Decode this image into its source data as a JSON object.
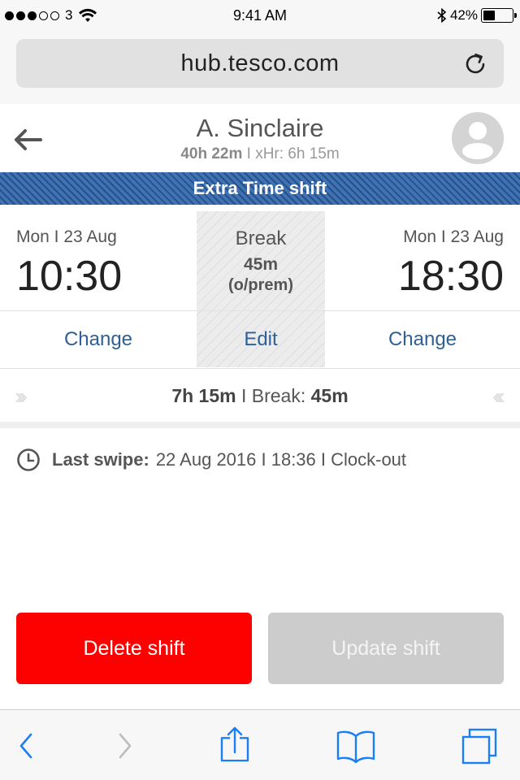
{
  "status_bar": {
    "signal_strength": "3 of 5",
    "carrier": "3",
    "time": "9:41 AM",
    "battery": "42%",
    "battery_level": 0.42
  },
  "browser": {
    "url": "hub.tesco.com"
  },
  "header": {
    "employee_name": "A. Sinclaire",
    "hours_total": "40h 22m",
    "hours_extra": "I xHr: 6h 15m"
  },
  "banner": {
    "label": "Extra Time shift"
  },
  "shift": {
    "start_day": "Mon I 23 Aug",
    "start_time": "10:30",
    "break_label": "Break",
    "break_value": "45m",
    "break_type": "(o/prem)",
    "end_day": "Mon I 23 Aug",
    "end_time": "18:30",
    "change_start_label": "Change",
    "edit_break_label": "Edit",
    "change_end_label": "Change"
  },
  "duration": {
    "total": "7h 15m",
    "break_prefix": " I Break: ",
    "break": "45m",
    "chevrons_left": "›››",
    "chevrons_right": "‹‹‹"
  },
  "last_swipe": {
    "label": "Last swipe:",
    "value": "22 Aug 2016 I 18:36 I Clock-out"
  },
  "actions": {
    "delete_label": "Delete shift",
    "update_label": "Update shift"
  },
  "colors": {
    "banner": "#3f73b4",
    "link": "#2f5f96",
    "delete": "#fd0000",
    "update_disabled": "#cccccc",
    "ios_blue": "#1a7ef5"
  },
  "icons": {
    "back": "arrow-left-icon",
    "avatar": "user-avatar-icon",
    "reload": "reload-icon",
    "clock": "clock-icon",
    "toolbar": [
      "chevron-left-icon",
      "chevron-right-icon",
      "share-icon",
      "bookmarks-icon",
      "tabs-icon"
    ]
  }
}
